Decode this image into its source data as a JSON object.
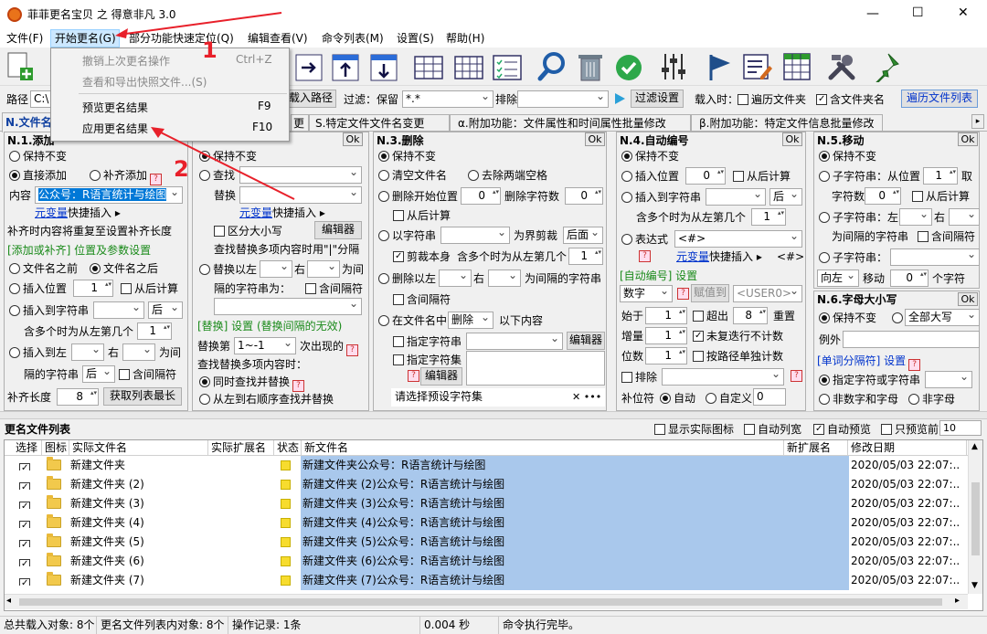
{
  "window": {
    "title": "菲菲更名宝贝 之 得意非凡 3.0",
    "controls": [
      "—",
      "☐",
      "✕"
    ]
  },
  "menubar": [
    "文件(F)",
    "开始更名(G)",
    "部分功能快速定位(Q)",
    "编辑查看(V)",
    "命令列表(M)",
    "设置(S)",
    "帮助(H)"
  ],
  "dropdown": {
    "items": [
      {
        "label": "撤销上次更名操作",
        "shortcut": "Ctrl+Z",
        "enabled": false
      },
      {
        "label": "查看和导出快照文件...(S)",
        "shortcut": "",
        "enabled": false
      },
      {
        "label": "预览更名结果",
        "shortcut": "F9",
        "enabled": true
      },
      {
        "label": "应用更名结果",
        "shortcut": "F10",
        "enabled": true
      }
    ]
  },
  "annotations": {
    "step1": "1",
    "step2": "2",
    "color": "#e8202a"
  },
  "pathbar": {
    "path_label": "路径",
    "path_value": "C:\\",
    "load_btn": "载入路径",
    "filter_label": "过滤：保留",
    "filter_value": "*.*",
    "exclude_label": "排除",
    "filter_settings_btn": "过滤设置",
    "load_time_label": "载入时：",
    "traverse_folder": "遍历文件夹",
    "include_folder_name": "含文件夹名",
    "traverse_list_btn": "遍历文件列表"
  },
  "tabs": [
    "N.文件名",
    "S.特定文件文件名变更",
    "α.附加功能：文件属性和时间属性批量修改",
    "β.附加功能：特定文件信息批量修改"
  ],
  "tab_partial": "更",
  "ok": "Ok",
  "help": "?",
  "p1": {
    "title": "N.1.添加",
    "keep": "保持不变",
    "direct_add": "直接添加",
    "pad_add": "补齐添加",
    "content_label": "内容",
    "content_value": "公众号：R语言统计与绘图",
    "var_link": "元变量",
    "quick_insert": "快捷插入 ▸",
    "note": "补齐时内容将重复至设置补齐长度",
    "group": "[添加或补齐] 位置及参数设置",
    "before_name": "文件名之前",
    "after_name": "文件名之后",
    "insert_pos": "插入位置",
    "insert_pos_val": "1",
    "from_back": "从后计算",
    "insert_to_str": "插入到字符串",
    "after": "后",
    "multi_note": "含多个时为从左第几个",
    "multi_val": "1",
    "insert_between": "插入到左",
    "right": "右",
    "as_between": "为间",
    "between_str": "隔的字符串",
    "between_after": "后",
    "include_sep": "含间隔符",
    "pad_len": "补齐长度",
    "pad_len_val": "8",
    "get_max_btn": "获取列表最长"
  },
  "p2": {
    "keep": "保持不变",
    "find": "查找",
    "replace": "替换",
    "var_link": "元变量",
    "quick_insert": "快捷插入 ▸",
    "case": "区分大小写",
    "editor": "编辑器",
    "multi_note": "查找替换多项内容时用\"|\"分隔",
    "replace_left": "替换以左",
    "right": "右",
    "as_between": "为间",
    "between_str": "隔的字符串为：",
    "include_sep": "含间隔符",
    "group": "[替换] 设置 (替换间隔的无效)",
    "replace_nth": "替换第",
    "nth_val": "1~-1",
    "nth_suffix": "次出现的",
    "multi_find": "查找替换多项内容时：",
    "sync": "同时查找并替换",
    "sequential": "从左到右顺序查找并替换"
  },
  "p3": {
    "title": "N.3.删除",
    "keep": "保持不变",
    "clear_name": "清空文件名",
    "remove_spaces": "去除两端空格",
    "del_start": "删除开始位置",
    "del_start_val": "0",
    "del_count": "删除字符数",
    "del_count_val": "0",
    "from_back": "从后计算",
    "to_string": "以字符串",
    "as_cut": "为界剪裁",
    "cut_after": "后面",
    "cut_self": "剪裁本身",
    "multi_note": "含多个时为从左第几个",
    "multi_val": "1",
    "del_left": "删除以左",
    "right": "右",
    "as_between": "为间隔的字符串",
    "include_sep": "含间隔符",
    "in_name": "在文件名中",
    "in_name_action": "删除",
    "below": "以下内容",
    "specify_str": "指定字符串",
    "editor": "编辑器",
    "specify_set": "指定字符集",
    "editor2": "编辑器",
    "charset_select": "请选择预设字符集",
    "clear": "✕ •••"
  },
  "p4": {
    "title": "N.4.自动编号",
    "keep": "保持不变",
    "insert_pos": "插入位置",
    "insert_pos_val": "0",
    "from_back": "从后计算",
    "insert_to_str": "插入到字符串",
    "after": "后",
    "multi_note": "含多个时为从左第几个",
    "multi_val": "1",
    "expr": "表达式",
    "expr_val": "<#>",
    "var_link": "元变量",
    "quick_insert": "快捷插入 ▸",
    "quick_val": "<#>",
    "group": "[自动编号] 设置",
    "type": "数字",
    "assign_to": "赋值到",
    "user_var": "<USER0>",
    "start_at": "始于",
    "start_val": "1",
    "overflow": "超出",
    "overflow_val": "8",
    "reset": "重置",
    "step": "增量",
    "step_val": "1",
    "no_repeat": "未复迭行不计数",
    "digits": "位数",
    "digits_val": "1",
    "per_path": "按路径单独计数",
    "exclude": "排除",
    "pad_char": "补位符",
    "auto": "自动",
    "custom": "自定义",
    "custom_val": "0"
  },
  "p5": {
    "title": "N.5.移动",
    "keep": "保持不变",
    "substr_from": "子字符串：从位置",
    "from_val": "1",
    "take": "取",
    "char_count": "字符数",
    "char_count_val": "0",
    "from_back": "从后计算",
    "substr_left": "子字符串：左",
    "right": "右",
    "between_str": "为间隔的字符串",
    "include_sep": "含间隔符",
    "substr": "子字符串：",
    "direction": "向左",
    "move": "移动",
    "move_val": "0",
    "move_unit": "个字符"
  },
  "p6": {
    "title": "N.6.字母大小写",
    "keep": "保持不变",
    "all_upper": "全部大写",
    "except": "例外",
    "group": "[单词分隔符] 设置",
    "specify": "指定字符或字符串",
    "non_alnum": "非数字和字母",
    "non_alpha": "非字母"
  },
  "list": {
    "title": "更名文件列表",
    "show_icon": "显示实际图标",
    "auto_width": "自动列宽",
    "auto_preview": "自动预览",
    "preview_only": "只预览前",
    "preview_count": "10",
    "columns": [
      "选择",
      "图标",
      "实际文件名",
      "实际扩展名",
      "状态",
      "新文件名",
      "新扩展名",
      "修改日期"
    ],
    "rows": [
      {
        "name": "新建文件夹",
        "new": "新建文件夹公众号：R语言统计与绘图",
        "date": "2020/05/03 22:07:.."
      },
      {
        "name": "新建文件夹 (2)",
        "new": "新建文件夹 (2)公众号：R语言统计与绘图",
        "date": "2020/05/03 22:07:.."
      },
      {
        "name": "新建文件夹 (3)",
        "new": "新建文件夹 (3)公众号：R语言统计与绘图",
        "date": "2020/05/03 22:07:.."
      },
      {
        "name": "新建文件夹 (4)",
        "new": "新建文件夹 (4)公众号：R语言统计与绘图",
        "date": "2020/05/03 22:07:.."
      },
      {
        "name": "新建文件夹 (5)",
        "new": "新建文件夹 (5)公众号：R语言统计与绘图",
        "date": "2020/05/03 22:07:.."
      },
      {
        "name": "新建文件夹 (6)",
        "new": "新建文件夹 (6)公众号：R语言统计与绘图",
        "date": "2020/05/03 22:07:.."
      },
      {
        "name": "新建文件夹 (7)",
        "new": "新建文件夹 (7)公众号：R语言统计与绘图",
        "date": "2020/05/03 22:07:.."
      }
    ]
  },
  "status": {
    "total": "总共载入对象: 8个",
    "list_objects": "更名文件列表内对象: 8个",
    "ops": "操作记录: 1条",
    "time": "0.004 秒",
    "msg": "命令执行完毕。"
  },
  "colors": {
    "accent": "#0078d7",
    "selected_row": "#a9c8ec",
    "menu_highlight": "#cce8ff",
    "group_green": "#1a8a1a",
    "link_blue": "#0033cc"
  }
}
